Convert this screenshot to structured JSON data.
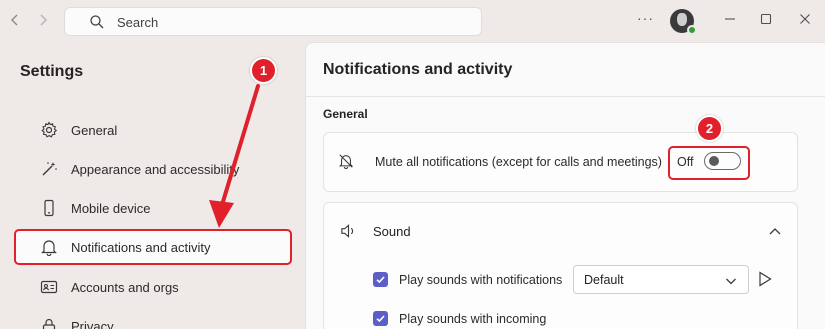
{
  "titlebar": {
    "back_icon": "chevron-left-icon",
    "forward_icon": "chevron-right-icon",
    "search": {
      "placeholder": "Search",
      "icon": "search-icon"
    },
    "more_label": "···",
    "window_controls": [
      "minimize-icon",
      "maximize-icon",
      "close-icon"
    ]
  },
  "sidebar": {
    "title": "Settings",
    "items": [
      {
        "label": "General",
        "icon": "gear-icon"
      },
      {
        "label": "Appearance and accessibility",
        "icon": "magic-wand-icon"
      },
      {
        "label": "Mobile device",
        "icon": "phone-icon"
      },
      {
        "label": "Notifications and activity",
        "icon": "bell-icon",
        "selected": true
      },
      {
        "label": "Accounts and orgs",
        "icon": "id-card-icon"
      },
      {
        "label": "Privacy",
        "icon": "lock-icon"
      }
    ]
  },
  "main": {
    "title": "Notifications and activity",
    "section_general": "General",
    "mute": {
      "label": "Mute all notifications (except for calls and meetings)",
      "state_label": "Off",
      "on": false
    },
    "sound": {
      "label": "Sound",
      "expanded": true,
      "options": [
        {
          "label": "Play sounds with notifications",
          "checked": true,
          "dropdown_value": "Default"
        },
        {
          "label": "Play sounds with incoming",
          "checked": true
        }
      ]
    }
  },
  "annotations": {
    "callout_1": "1",
    "callout_2": "2"
  },
  "colors": {
    "accent": "#5b5fc7",
    "annotation_red": "#e0202a",
    "background": "#efe9e8",
    "panel": "#fafafa"
  }
}
